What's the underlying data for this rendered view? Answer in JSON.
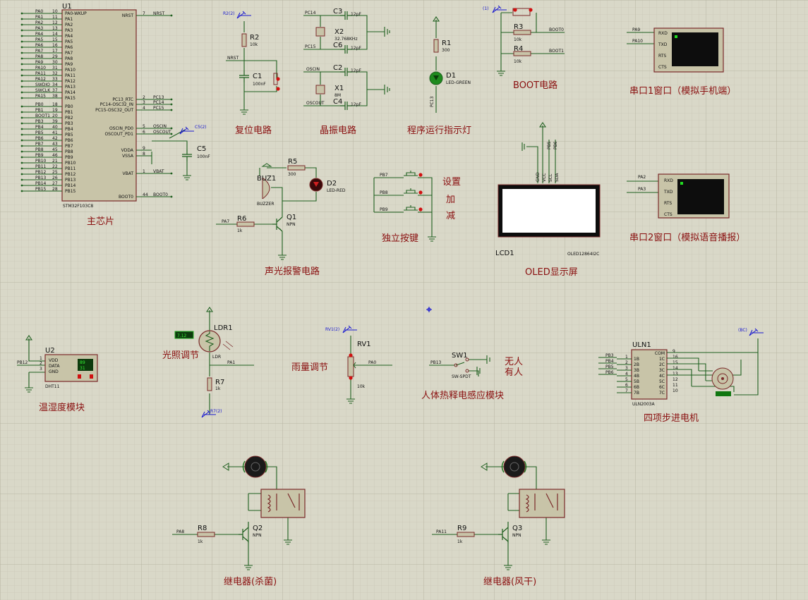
{
  "mcu": {
    "ref": "U1",
    "part": "STM32F103C8",
    "name": "主芯片",
    "left_pins": [
      {
        "net": "PA0",
        "num": "10",
        "name": "PA0-WKUP"
      },
      {
        "net": "PA1",
        "num": "11",
        "name": "PA1"
      },
      {
        "net": "PA2",
        "num": "12",
        "name": "PA2"
      },
      {
        "net": "PA3",
        "num": "13",
        "name": "PA3"
      },
      {
        "net": "PA4",
        "num": "14",
        "name": "PA4"
      },
      {
        "net": "PA5",
        "num": "15",
        "name": "PA5"
      },
      {
        "net": "PA6",
        "num": "16",
        "name": "PA6"
      },
      {
        "net": "PA7",
        "num": "17",
        "name": "PA7"
      },
      {
        "net": "PA8",
        "num": "29",
        "name": "PA8"
      },
      {
        "net": "PA9",
        "num": "30",
        "name": "PA9"
      },
      {
        "net": "PA10",
        "num": "31",
        "name": "PA10"
      },
      {
        "net": "PA11",
        "num": "32",
        "name": "PA11"
      },
      {
        "net": "PA12",
        "num": "33",
        "name": "PA12"
      },
      {
        "net": "SWDIO",
        "num": "34",
        "name": "PA13"
      },
      {
        "net": "SWCLK",
        "num": "37",
        "name": "PA14"
      },
      {
        "net": "PA15",
        "num": "38",
        "name": "PA15"
      },
      {
        "net": "PB0",
        "num": "18",
        "name": "PB0"
      },
      {
        "net": "PB1",
        "num": "19",
        "name": "PB1"
      },
      {
        "net": "BOOT1",
        "num": "20",
        "name": "PB2"
      },
      {
        "net": "PB3",
        "num": "39",
        "name": "PB3"
      },
      {
        "net": "PB4",
        "num": "40",
        "name": "PB4"
      },
      {
        "net": "PB5",
        "num": "41",
        "name": "PB5"
      },
      {
        "net": "PB6",
        "num": "42",
        "name": "PB6"
      },
      {
        "net": "PB7",
        "num": "43",
        "name": "PB7"
      },
      {
        "net": "PB8",
        "num": "45",
        "name": "PB8"
      },
      {
        "net": "PB9",
        "num": "46",
        "name": "PB9"
      },
      {
        "net": "PB10",
        "num": "21",
        "name": "PB10"
      },
      {
        "net": "PB11",
        "num": "22",
        "name": "PB11"
      },
      {
        "net": "PB12",
        "num": "25",
        "name": "PB12"
      },
      {
        "net": "PB13",
        "num": "26",
        "name": "PB13"
      },
      {
        "net": "PB14",
        "num": "27",
        "name": "PB14"
      },
      {
        "net": "PB15",
        "num": "28",
        "name": "PB15"
      }
    ],
    "right_pins": [
      {
        "name": "NRST",
        "num": "7",
        "net": "NRST"
      },
      {
        "name": "PC13_RTC",
        "num": "2",
        "net": "PC13"
      },
      {
        "name": "PC14-OSC32_IN",
        "num": "3",
        "net": "PC14"
      },
      {
        "name": "PC15-OSC32_OUT",
        "num": "4",
        "net": "PC15"
      },
      {
        "name": "OSCIN_PD0",
        "num": "5",
        "net": "OSCIN"
      },
      {
        "name": "OSCOUT_PD1",
        "num": "6",
        "net": "OSCOUT"
      },
      {
        "name": "VDDA",
        "num": "9",
        "net": ""
      },
      {
        "name": "VSSA",
        "num": "8",
        "net": ""
      },
      {
        "name": "VBAT",
        "num": "1",
        "net": "VBAT"
      },
      {
        "name": "BOOT0",
        "num": "44",
        "net": "BOOT0"
      }
    ],
    "c5": {
      "ref": "C5",
      "val": "100nF"
    },
    "probe": "C5(2)"
  },
  "reset": {
    "title": "复位电路",
    "r2": "R2",
    "r2v": "10k",
    "c1": "C1",
    "c1v": "100nF",
    "net": "NRST",
    "probe": "R2(2)"
  },
  "crystal": {
    "title": "晶振电路",
    "c3": "C3",
    "c6": "C6",
    "c2": "C2",
    "c4": "C4",
    "cv": "12pF",
    "x2": "X2",
    "x2v": "32.768KHz",
    "x1": "X1",
    "x1v": "8M",
    "n1": "PC14",
    "n2": "PC15",
    "n3": "OSCIN",
    "n4": "OSCOUT"
  },
  "led": {
    "title": "程序运行指示灯",
    "r1": "R1",
    "r1v": "300",
    "d1": "D1",
    "d1v": "LED-GREEN",
    "net": "PC13"
  },
  "boot": {
    "title": "BOOT电路",
    "r3": "R3",
    "r4": "R4",
    "rv": "10k",
    "n1": "BOOT0",
    "n2": "BOOT1",
    "probe": "(1)"
  },
  "uart1": {
    "title": "串口1窗口（模拟手机端）",
    "n1": "PA9",
    "n2": "PA10",
    "pins": [
      "RXD",
      "TXD",
      "RTS",
      "CTS"
    ]
  },
  "uart2": {
    "title": "串口2窗口（模拟语音播报）",
    "n1": "PA2",
    "n2": "PA3",
    "pins": [
      "RXD",
      "TXD",
      "RTS",
      "CTS"
    ]
  },
  "alarm": {
    "title": "声光报警电路",
    "buz": "BUZ1",
    "buzv": "BUZZER",
    "r5": "R5",
    "r5v": "300",
    "d2": "D2",
    "d2v": "LED-RED",
    "r6": "R6",
    "r6v": "1k",
    "q1": "Q1",
    "q1v": "NPN",
    "net": "PA7"
  },
  "keys": {
    "title": "独立按键",
    "n1": "PB7",
    "n2": "PB8",
    "n3": "PB9",
    "l1": "设置",
    "l2": "加",
    "l3": "减"
  },
  "oled": {
    "title": "OLED显示屏",
    "ref": "LCD1",
    "part": "OLED12864I2C",
    "pins": [
      "GND",
      "VCC",
      "SCL",
      "SDA"
    ],
    "n1": "PB5",
    "n2": "PB6"
  },
  "dht": {
    "title": "温湿度模块",
    "ref": "U2",
    "part": "DHT11",
    "net": "PB12",
    "pins": [
      "VDD",
      "DATA",
      "GND"
    ],
    "v1": "89",
    "v2": "31",
    "pn1": "1",
    "pn2": "2",
    "pn3": "3"
  },
  "ldr": {
    "title": "光照调节",
    "ref": "LDR1",
    "part": "LDR",
    "r7": "R7",
    "r7v": "1k",
    "net": "PA1",
    "probe": "R7(2)",
    "meter": "7.12"
  },
  "rain": {
    "title": "雨量调节",
    "ref": "RV1",
    "val": "10k",
    "net": "PA0",
    "probe": "RV1(2)"
  },
  "pir": {
    "title": "人体热释电感应模块",
    "ref": "SW1",
    "part": "SW-SPDT",
    "net": "PB13",
    "l1": "无人",
    "l2": "有人"
  },
  "stepper": {
    "title": "四项步进电机",
    "ref": "ULN1",
    "part": "ULN2003A",
    "probe": "(BC)",
    "nets": [
      "PB3",
      "PB4",
      "PB5",
      "PB6"
    ],
    "in": [
      "1B",
      "2B",
      "3B",
      "4B",
      "5B",
      "6B",
      "7B"
    ],
    "out": [
      "1C",
      "2C",
      "3C",
      "4C",
      "5C",
      "6C",
      "7C"
    ],
    "com": "COM",
    "lnum": [
      "1",
      "2",
      "3",
      "4",
      "5",
      "6",
      "7"
    ],
    "rnum": [
      "16",
      "15",
      "14",
      "13",
      "12",
      "11",
      "10"
    ],
    "comnum": "9"
  },
  "relay1": {
    "title": "继电器(杀菌)",
    "r": "R8",
    "rv": "1k",
    "q": "Q2",
    "qv": "NPN",
    "net": "PA8"
  },
  "relay2": {
    "title": "继电器(风干)",
    "r": "R9",
    "rv": "1k",
    "q": "Q3",
    "qv": "NPN",
    "net": "PA11"
  },
  "colors": {
    "wire": "#1f5f1f",
    "body": "#c8c4a8",
    "label": "#8a1010",
    "probe": "#1a1ad0",
    "background": "#d9d8c8"
  }
}
